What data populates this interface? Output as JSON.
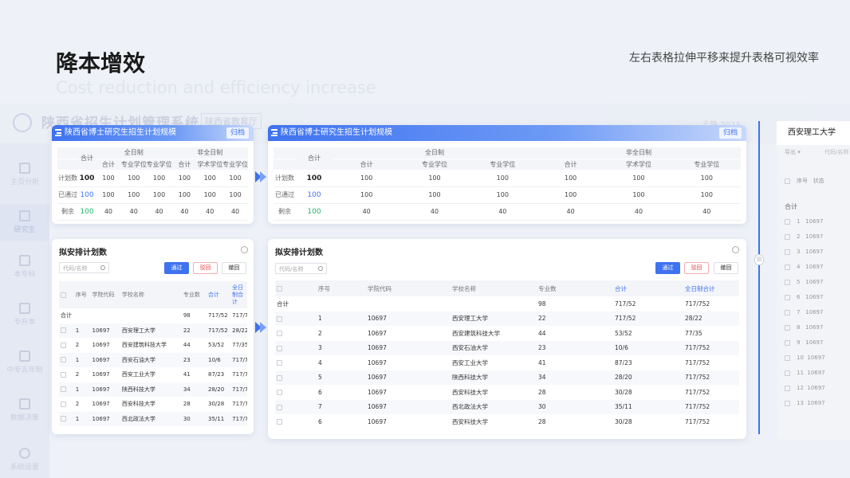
{
  "slide": {
    "title": "降本增效",
    "subtitle": "Cost reduction and efficiency increase",
    "note": "左右表格拉伸平移来提升表格可视效率"
  },
  "background_app": {
    "system_title": "陕西省招生计划管理系统",
    "dept": "陕西省教育厅",
    "user": "孟静 2023",
    "nav": [
      "主页分析",
      "研究生",
      "本专科",
      "专升本",
      "中专五年制",
      "数据决策",
      "系统设置"
    ]
  },
  "plan_scale": {
    "title": "陕西省博士研究生招生计划规模",
    "tag": "归档",
    "group_fulltime": "全日制",
    "group_parttime": "非全日制",
    "col_total": "合计",
    "subcols": [
      "合计",
      "专业学位",
      "专业学位",
      "合计",
      "学术学位",
      "专业学位"
    ],
    "rows": [
      {
        "label": "计划数",
        "total": "100",
        "vals": [
          "100",
          "100",
          "100",
          "100",
          "100",
          "100"
        ]
      },
      {
        "label": "已通过",
        "total": "100",
        "vals": [
          "100",
          "100",
          "100",
          "100",
          "100",
          "100"
        ]
      },
      {
        "label": "剩余",
        "total": "100",
        "vals": [
          "40",
          "40",
          "40",
          "40",
          "40",
          "40"
        ]
      }
    ]
  },
  "arrange": {
    "title": "拟安排计划数",
    "search_placeholder": "代码/名称",
    "btn_approve": "通过",
    "btn_reject": "驳回",
    "btn_revoke": "撤回",
    "headers": {
      "seq": "序号",
      "code": "学院代码",
      "name": "学校名称",
      "majors": "专业数",
      "total": "合计",
      "fulltime_total": "全日制合计"
    },
    "sum": {
      "label": "合计",
      "majors": "98",
      "total": "717/52",
      "fulltime_total": "717/752"
    },
    "rows": [
      {
        "seq": "1",
        "code": "10697",
        "name": "西安理工大学",
        "majors": "22",
        "total": "717/52",
        "fulltime_total": "28/22"
      },
      {
        "seq": "2",
        "code": "10697",
        "name": "西安建筑科技大学",
        "majors": "44",
        "total": "53/52",
        "fulltime_total": "77/35"
      },
      {
        "seq": "3",
        "code": "10697",
        "name": "西安石油大学",
        "majors": "23",
        "total": "10/6",
        "fulltime_total": "717/752"
      },
      {
        "seq": "4",
        "code": "10697",
        "name": "西安工业大学",
        "majors": "41",
        "total": "87/23",
        "fulltime_total": "717/752"
      },
      {
        "seq": "5",
        "code": "10697",
        "name": "陕西科技大学",
        "majors": "34",
        "total": "28/20",
        "fulltime_total": "717/752"
      },
      {
        "seq": "6",
        "code": "10697",
        "name": "西安科技大学",
        "majors": "28",
        "total": "30/28",
        "fulltime_total": "717/752"
      },
      {
        "seq": "7",
        "code": "10697",
        "name": "西北政法大学",
        "majors": "30",
        "total": "35/11",
        "fulltime_total": "717/752"
      },
      {
        "seq": "6",
        "code": "10697",
        "name": "西安科技大学",
        "majors": "28",
        "total": "30/28",
        "fulltime_total": "717/752"
      }
    ],
    "small_seq": [
      "1",
      "2",
      "1",
      "2",
      "1",
      "2",
      "1"
    ]
  },
  "right_panel": {
    "title": "西安理工大学",
    "export": "导出",
    "search_placeholder": "代码/名称",
    "headers": {
      "seq": "序号",
      "status": "状态"
    },
    "sum": "合计",
    "seq": [
      "1",
      "2",
      "3",
      "4",
      "5",
      "6",
      "7",
      "8",
      "9",
      "10",
      "11",
      "12",
      "13"
    ],
    "code": "10697"
  }
}
